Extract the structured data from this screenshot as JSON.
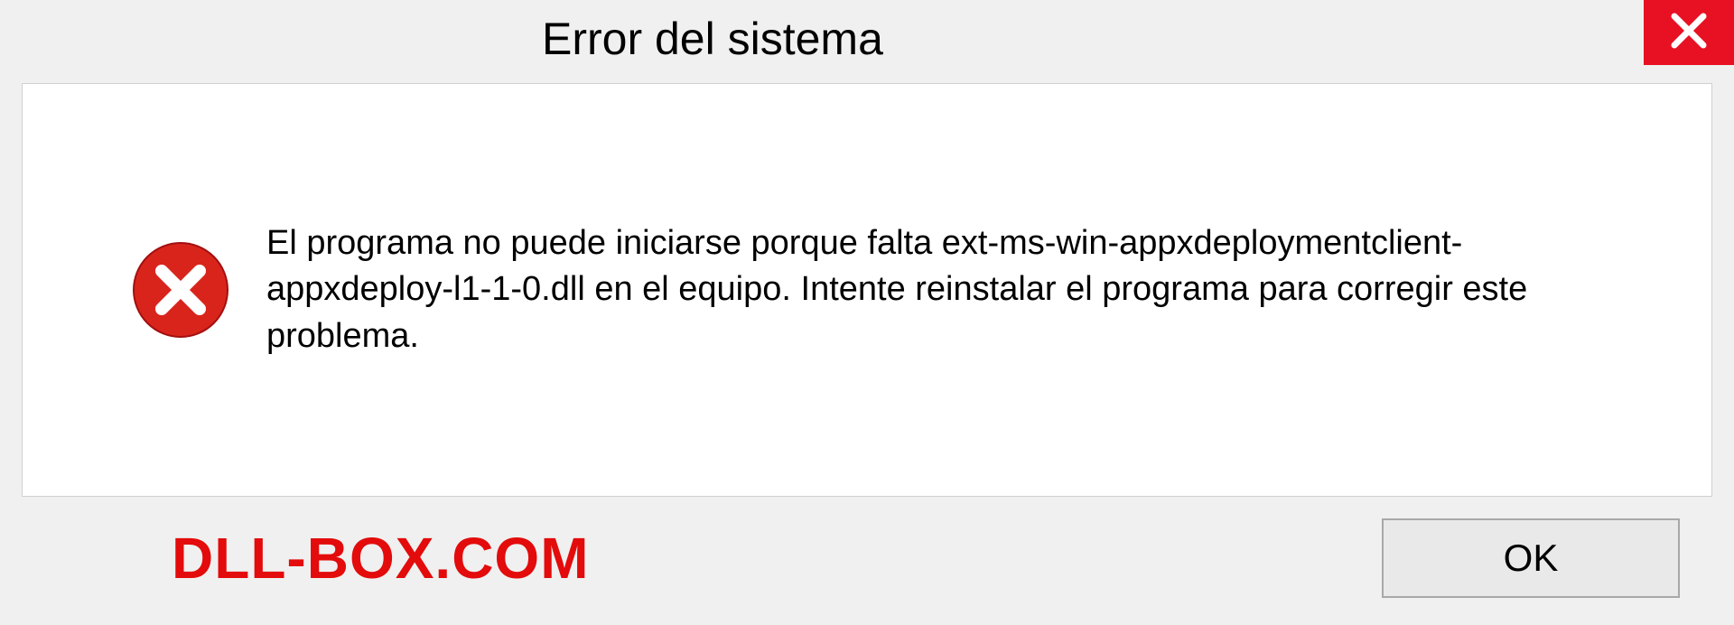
{
  "titlebar": {
    "title": "Error del sistema"
  },
  "message": {
    "text": "El programa no puede iniciarse porque falta ext-ms-win-appxdeploymentclient-appxdeploy-l1-1-0.dll en el equipo. Intente reinstalar el programa para corregir este problema."
  },
  "footer": {
    "watermark": "DLL-BOX.COM",
    "ok_label": "OK"
  },
  "colors": {
    "close_bg": "#e81123",
    "error_icon": "#d9241c",
    "watermark": "#e30b0b"
  }
}
